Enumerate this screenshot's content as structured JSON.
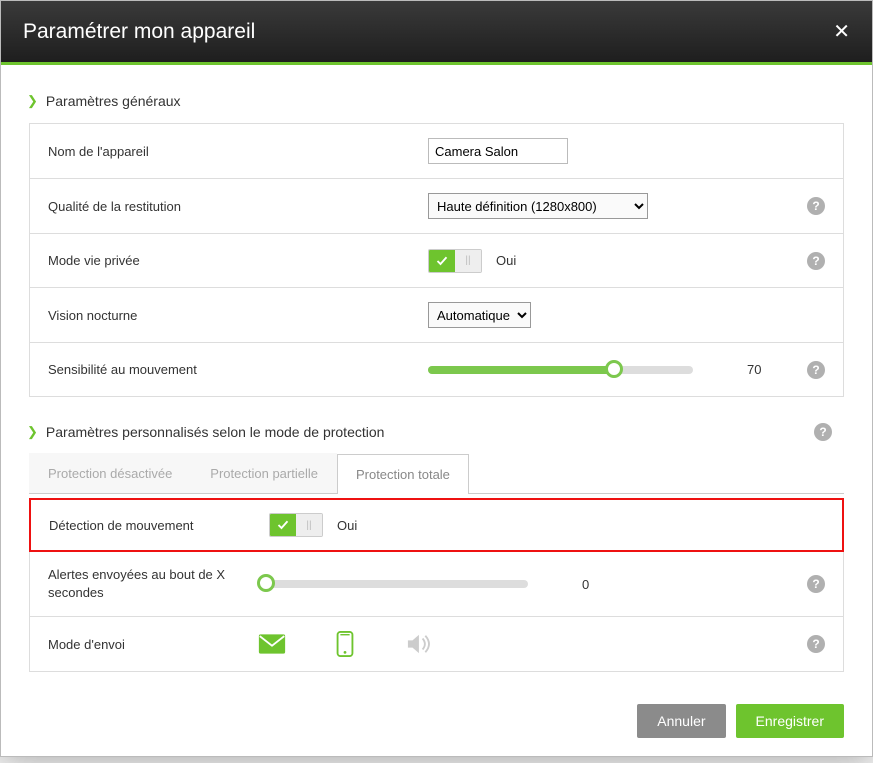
{
  "header": {
    "title": "Paramétrer mon appareil"
  },
  "section_general": {
    "title": "Paramètres généraux",
    "device_name_label": "Nom de l'appareil",
    "device_name_value": "Camera Salon",
    "quality_label": "Qualité de la restitution",
    "quality_value": "Haute définition (1280x800)",
    "privacy_label": "Mode vie privée",
    "privacy_value": "Oui",
    "nightvision_label": "Vision nocturne",
    "nightvision_value": "Automatique",
    "sensitivity_label": "Sensibilité au mouvement",
    "sensitivity_value": "70"
  },
  "section_custom": {
    "title": "Paramètres personnalisés selon le mode de protection",
    "tabs": {
      "off": "Protection désactivée",
      "partial": "Protection partielle",
      "total": "Protection totale"
    },
    "motion_label": "Détection de mouvement",
    "motion_value": "Oui",
    "alert_delay_label": "Alertes envoyées au bout de X secondes",
    "alert_delay_value": "0",
    "send_mode_label": "Mode d'envoi"
  },
  "footer": {
    "cancel": "Annuler",
    "save": "Enregistrer"
  },
  "colors": {
    "accent": "#6ec42e"
  }
}
